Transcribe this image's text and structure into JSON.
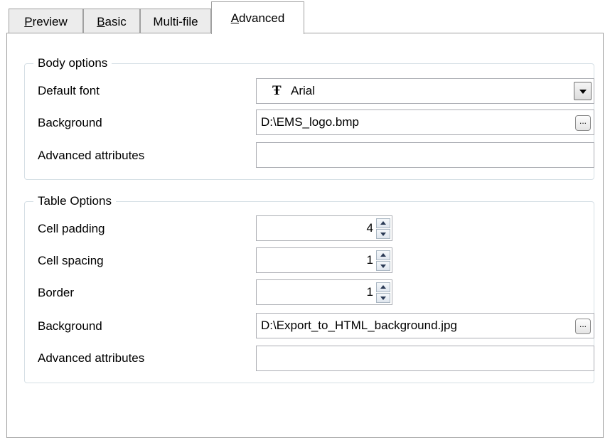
{
  "tabs": [
    {
      "label": "Preview",
      "accel": "P",
      "rest": "review"
    },
    {
      "label": "Basic",
      "accel": "B",
      "rest": "asic"
    },
    {
      "label": "Multi-file",
      "accel": "",
      "rest": "Multi-file"
    },
    {
      "label": "Advanced",
      "accel": "A",
      "rest": "dvanced"
    }
  ],
  "active_tab": "Advanced",
  "body_options": {
    "legend": "Body options",
    "default_font_label": "Default font",
    "default_font_value": "Arial",
    "font_icon_glyph": "Ŧ",
    "background_label": "Background",
    "background_value": "D:\\EMS_logo.bmp",
    "advanced_attributes_label": "Advanced attributes",
    "advanced_attributes_value": ""
  },
  "table_options": {
    "legend": "Table Options",
    "cell_padding_label": "Cell padding",
    "cell_padding_value": "4",
    "cell_spacing_label": "Cell spacing",
    "cell_spacing_value": "1",
    "border_label": "Border",
    "border_value": "1",
    "background_label": "Background",
    "background_value": "D:\\Export_to_HTML_background.jpg",
    "advanced_attributes_label": "Advanced attributes",
    "advanced_attributes_value": ""
  },
  "browse_button_label": "...",
  "icons": {
    "combo_arrow": "chevron-down-icon",
    "browse": "ellipsis-icon",
    "spin_up": "arrow-up-icon",
    "spin_down": "arrow-down-icon",
    "font": "truetype-font-icon"
  }
}
